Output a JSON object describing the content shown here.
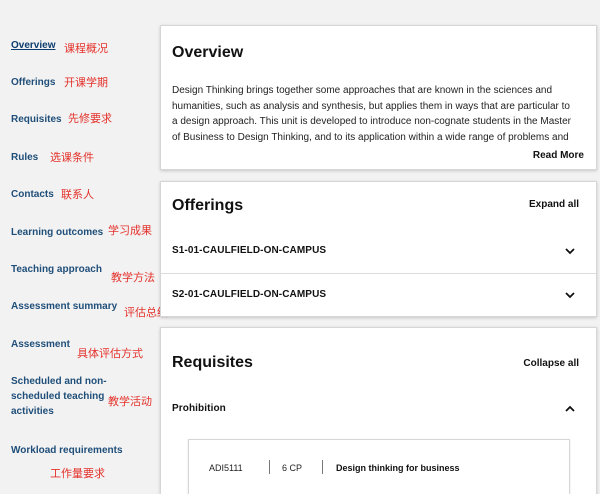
{
  "sidebar": {
    "items": [
      {
        "label": "Overview",
        "note": "课程概况"
      },
      {
        "label": "Offerings",
        "note": "开课学期"
      },
      {
        "label": "Requisites",
        "note": "先修要求"
      },
      {
        "label": "Rules",
        "note": "选课条件"
      },
      {
        "label": "Contacts",
        "note": "联系人"
      },
      {
        "label": "Learning outcomes",
        "note": "学习成果"
      },
      {
        "label": "Teaching approach",
        "note": "教学方法"
      },
      {
        "label": "Assessment summary",
        "note": "评估总结"
      },
      {
        "label": "Assessment",
        "note": "具体评估方式"
      },
      {
        "label_lines": [
          "Scheduled and non-",
          "scheduled teaching",
          "activities"
        ],
        "note": "教学活动"
      },
      {
        "label": "Workload requirements",
        "note": "工作量要求"
      }
    ]
  },
  "overview": {
    "title": "Overview",
    "text": "Design Thinking brings together some approaches that are known in the sciences and humanities, such as analysis and synthesis, but applies them in ways that are particular to a design approach. This unit is developed to introduce non-cognate students in the Master of Business to Design Thinking, and to its application within a wide range of problems and",
    "read_more": "Read More"
  },
  "offerings": {
    "title": "Offerings",
    "expand_all": "Expand all",
    "rows": [
      "S1-01-CAULFIELD-ON-CAMPUS",
      "S2-01-CAULFIELD-ON-CAMPUS"
    ]
  },
  "requisites": {
    "title": "Requisites",
    "collapse_all": "Collapse all",
    "section": "Prohibition",
    "unit": {
      "code": "ADI5111",
      "cp": "6 CP",
      "name": "Design thinking for business"
    }
  },
  "icons": {
    "chevron_down": "chevron-down-icon",
    "chevron_up": "chevron-up-icon"
  },
  "colors": {
    "nav_link": "#1f4e79",
    "annotation": "#e4322b",
    "background": "#f2f2f2"
  }
}
